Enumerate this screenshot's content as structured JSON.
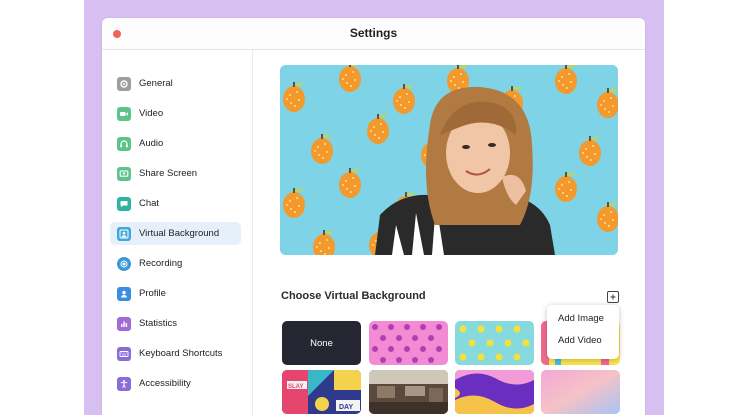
{
  "window": {
    "title": "Settings"
  },
  "sidebar": {
    "items": [
      {
        "label": "General",
        "icon": "gear-icon",
        "color": "#9e9e9e"
      },
      {
        "label": "Video",
        "icon": "video-camera-icon",
        "color": "#5cc48a"
      },
      {
        "label": "Audio",
        "icon": "headphones-icon",
        "color": "#5cc48a"
      },
      {
        "label": "Share Screen",
        "icon": "share-screen-icon",
        "color": "#5cc48a"
      },
      {
        "label": "Chat",
        "icon": "chat-bubble-icon",
        "color": "#31b3a4"
      },
      {
        "label": "Virtual Background",
        "icon": "person-portrait-icon",
        "color": "#3ea8d8",
        "active": true
      },
      {
        "label": "Recording",
        "icon": "record-icon",
        "color": "#3a9ad9"
      },
      {
        "label": "Profile",
        "icon": "user-icon",
        "color": "#3a8fe0"
      },
      {
        "label": "Statistics",
        "icon": "bar-chart-icon",
        "color": "#a36ad6"
      },
      {
        "label": "Keyboard Shortcuts",
        "icon": "keyboard-icon",
        "color": "#8c6bd8"
      },
      {
        "label": "Accessibility",
        "icon": "accessibility-icon",
        "color": "#8c6bd8"
      }
    ]
  },
  "main": {
    "section_title": "Choose Virtual Background",
    "thumbnails": [
      {
        "label": "None",
        "kind": "none"
      },
      {
        "kind": "pink-pattern"
      },
      {
        "kind": "yellow-pattern"
      },
      {
        "kind": "colorful-stripes"
      },
      {
        "kind": "slay-day-poster"
      },
      {
        "kind": "cafe-photo"
      },
      {
        "kind": "purple-waves"
      },
      {
        "kind": "pastel-gradient"
      }
    ],
    "add_menu": {
      "items": [
        "Add Image",
        "Add Video"
      ]
    }
  },
  "colors": {
    "backdrop": "#d8bff2",
    "accent": "#e6f0fb",
    "preview_background": "#7fd3e6"
  }
}
